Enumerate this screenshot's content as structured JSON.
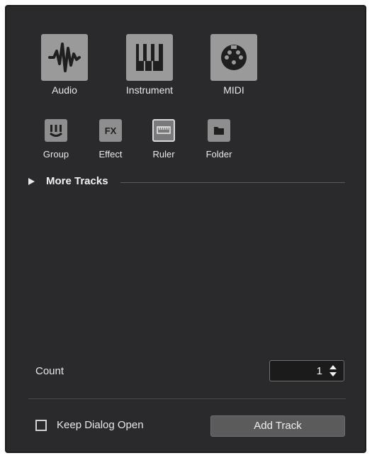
{
  "track_types": {
    "audio": {
      "label": "Audio",
      "icon": "waveform-icon"
    },
    "instrument": {
      "label": "Instrument",
      "icon": "piano-keys-icon"
    },
    "midi": {
      "label": "MIDI",
      "icon": "midi-din-icon"
    }
  },
  "small_types": {
    "group": {
      "label": "Group",
      "icon": "group-icon"
    },
    "effect": {
      "label": "Effect",
      "icon": "fx-icon",
      "icon_text": "FX"
    },
    "ruler": {
      "label": "Ruler",
      "icon": "ruler-icon",
      "selected": true
    },
    "folder": {
      "label": "Folder",
      "icon": "folder-icon"
    }
  },
  "more_tracks": {
    "label": "More Tracks"
  },
  "count": {
    "label": "Count",
    "value": "1"
  },
  "keep_open": {
    "label": "Keep Dialog Open",
    "checked": false
  },
  "add_button": {
    "label": "Add Track"
  }
}
